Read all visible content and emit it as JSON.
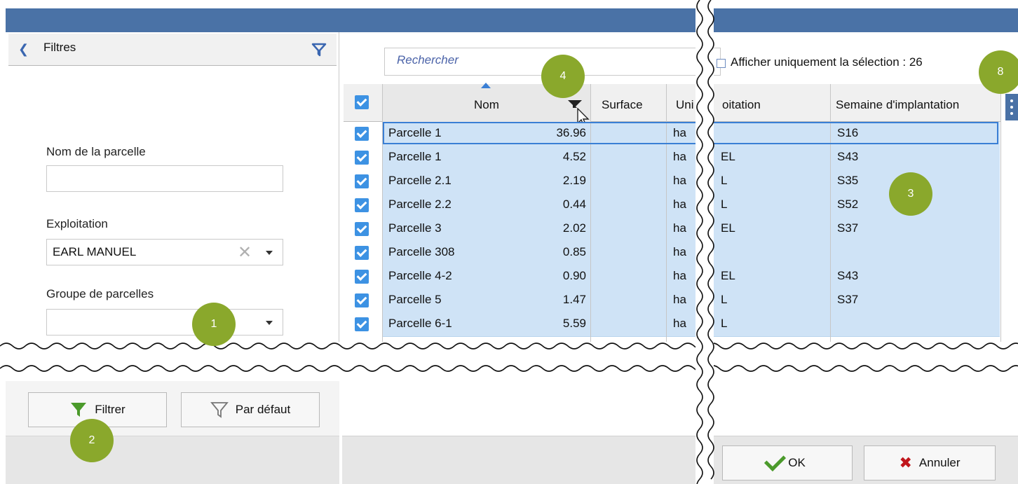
{
  "filters": {
    "title": "Filtres",
    "parcel_name_label": "Nom de la parcelle",
    "parcel_name_value": "",
    "exploitation_label": "Exploitation",
    "exploitation_value": "EARL MANUEL",
    "group_label": "Groupe de parcelles",
    "group_value": "",
    "filter_button": "Filtrer",
    "default_button": "Par défaut"
  },
  "search": {
    "placeholder": "Rechercher"
  },
  "selection_only": {
    "label": "Afficher uniquement la sélection : 26"
  },
  "grid": {
    "columns": [
      "Nom",
      "Surface",
      "Unité",
      "Exploitation",
      "Semaine d'implantation"
    ],
    "header_visible": {
      "name": "Nom",
      "surface": "Surface",
      "unit_partial": "Uni",
      "exploitation_partial": "oitation",
      "week": "Semaine d'implantation"
    },
    "rows": [
      {
        "nom": "Parcelle 1",
        "surface": "36.96",
        "unite": "ha",
        "expl": "",
        "semaine": "S16"
      },
      {
        "nom": "Parcelle 1",
        "surface": "4.52",
        "unite": "ha",
        "expl": "EL",
        "semaine": "S43"
      },
      {
        "nom": "Parcelle 2.1",
        "surface": "2.19",
        "unite": "ha",
        "expl": "L",
        "semaine": "S35"
      },
      {
        "nom": "Parcelle 2.2",
        "surface": "0.44",
        "unite": "ha",
        "expl": "L",
        "semaine": "S52"
      },
      {
        "nom": "Parcelle 3",
        "surface": "2.02",
        "unite": "ha",
        "expl": "EL",
        "semaine": "S37"
      },
      {
        "nom": "Parcelle 308",
        "surface": "0.85",
        "unite": "ha",
        "expl": "",
        "semaine": ""
      },
      {
        "nom": "Parcelle 4-2",
        "surface": "0.90",
        "unite": "ha",
        "expl": "EL",
        "semaine": "S43"
      },
      {
        "nom": "Parcelle 5",
        "surface": "1.47",
        "unite": "ha",
        "expl": "L",
        "semaine": "S37"
      },
      {
        "nom": "Parcelle 6-1",
        "surface": "5.59",
        "unite": "ha",
        "expl": "L",
        "semaine": ""
      }
    ]
  },
  "buttons": {
    "ok": "OK",
    "cancel": "Annuler"
  },
  "markers": [
    "1",
    "2",
    "3",
    "4",
    "8"
  ],
  "colors": {
    "titlebar": "#4a72a6",
    "selection": "#cfe3f6",
    "checkbox": "#3d92e3",
    "marker": "#8aa82c",
    "cancel": "#c0161c",
    "ok": "#4b9a2b"
  }
}
